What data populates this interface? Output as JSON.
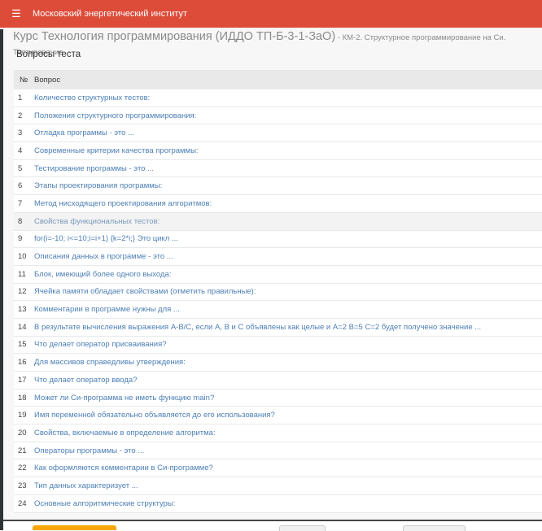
{
  "header": {
    "app_title": "Московский энергетический институт"
  },
  "course": {
    "title": "Курс Технология программирования (ИДДО ТП-Б-3-1-ЗаО)",
    "subtitle": " - КМ-2. Структурное программирование на Си. Тестирование"
  },
  "section_title": "Вопросы теста",
  "table": {
    "headers": [
      "№",
      "Вопрос"
    ],
    "rows": [
      [
        "1",
        "Количество структурных тестов:"
      ],
      [
        "2",
        "Положения структурного программирования:"
      ],
      [
        "3",
        "Отладка программы - это ..."
      ],
      [
        "4",
        "Современные критерии качества программы:"
      ],
      [
        "5",
        "Тестирование программы - это ..."
      ],
      [
        "6",
        "Этапы проектирования программы:"
      ],
      [
        "7",
        "Метод нисходящего проектирования алгоритмов:"
      ],
      [
        "8",
        "Свойства функциональных тестов:"
      ],
      [
        "9",
        "for(i=-10; i<=10;i=i+1) {k=2*i;} Это цикл ..."
      ],
      [
        "10",
        "Описания данных в программе - это ..."
      ],
      [
        "11",
        "Блок, имеющий более одного выхода:"
      ],
      [
        "12",
        "Ячейка памяти обладает свойствами (отметить правильные):"
      ],
      [
        "13",
        "Комментарии в программе нужны для ..."
      ],
      [
        "14",
        "В результате вычисления выражения A-B/C, если A, B и C объявлены как целые и A=2 B=5 C=2 будет получено значение ..."
      ],
      [
        "15",
        "Что делает оператор присваивания?"
      ],
      [
        "16",
        "Для массивов справедливы утверждения:"
      ],
      [
        "17",
        "Что делает оператор ввода?"
      ],
      [
        "18",
        "Может ли Си-программа не иметь функцию main?"
      ],
      [
        "19",
        "Имя переменной обязательно объявляется до его использования?"
      ],
      [
        "20",
        "Свойства, включаемые в определение алгоритма:"
      ],
      [
        "21",
        "Операторы программы - это ..."
      ],
      [
        "22",
        "Как оформляются комментарии в Си-программе?"
      ],
      [
        "23",
        "Тип данных характеризует ..."
      ],
      [
        "24",
        "Основные алгоритмические структуры:"
      ]
    ]
  }
}
